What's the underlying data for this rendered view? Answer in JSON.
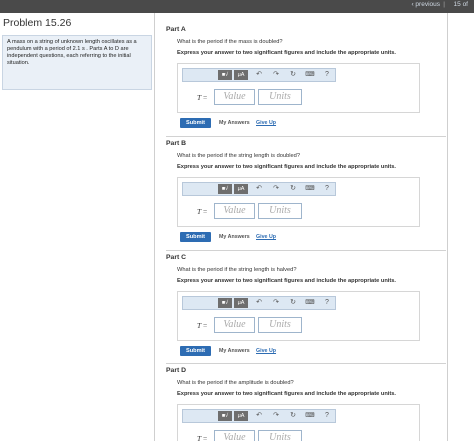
{
  "nav": {
    "previous": "‹ previous",
    "separator": "|",
    "count": "15 of"
  },
  "problem": {
    "title": "Problem 15.26",
    "text": "A mass on a string of unknown length oscillates as a pendulum with a period of 2.1 s . Parts A to D are independent questions, each referring to the initial situation."
  },
  "toolbar": {
    "templates": "■√",
    "mu": "μA",
    "undo": "↶",
    "redo": "↷",
    "reset": "↻",
    "keyboard": "⌨",
    "help": "?"
  },
  "common": {
    "instruction": "Express your answer to two significant figures and include the appropriate units.",
    "var": "T",
    "equals": " =",
    "value_placeholder": "Value",
    "units_placeholder": "Units",
    "submit": "Submit",
    "my_answers": "My Answers",
    "give_up": "Give Up"
  },
  "parts": [
    {
      "title": "Part A",
      "question": "What is the period if the mass is doubled?"
    },
    {
      "title": "Part B",
      "question": "What is the period if the string length is doubled?"
    },
    {
      "title": "Part C",
      "question": "What is the period if the string length is halved?"
    },
    {
      "title": "Part D",
      "question": "What is the period if the amplitude is doubled?"
    }
  ]
}
